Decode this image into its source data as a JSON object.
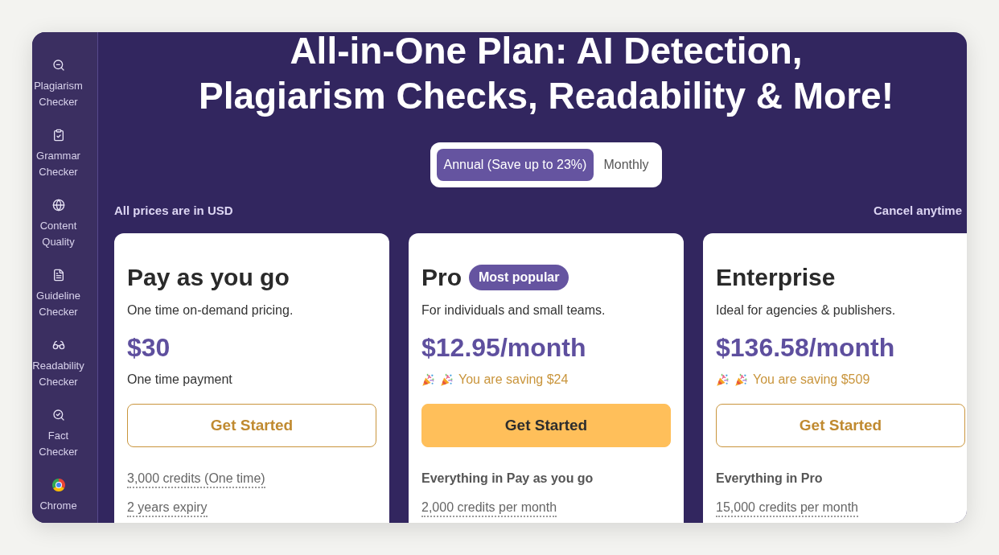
{
  "sidebar": {
    "items": [
      {
        "label": "Plagiarism Checker"
      },
      {
        "label": "Grammar Checker"
      },
      {
        "label": "Content Quality"
      },
      {
        "label": "Guideline Checker"
      },
      {
        "label": "Readability Checker"
      },
      {
        "label": "Fact Checker"
      },
      {
        "label": "Chrome"
      }
    ]
  },
  "title": "All-in-One Plan: AI Detection,\nPlagiarism Checks, Readability & More!",
  "billing_toggle": [
    {
      "label": "Annual (Save up to 23%)",
      "selected": true
    },
    {
      "label": "Monthly",
      "selected": false
    }
  ],
  "currency_note": "All prices are in USD",
  "cancel_note": "Cancel anytime",
  "plans": [
    {
      "name": "Pay as you go",
      "description": "One time on-demand pricing.",
      "price": "$30",
      "note": {
        "kind": "plain",
        "text": "One time payment"
      },
      "button": {
        "label": "Get Started",
        "filled": false
      },
      "features": [
        {
          "kind": "credit",
          "text": "3,000 credits (One time)"
        },
        {
          "kind": "credit",
          "text": "2 years expiry"
        }
      ]
    },
    {
      "name": "Pro",
      "badge": "Most popular",
      "description": "For individuals and small teams.",
      "price": "$12.95/month",
      "note": {
        "kind": "saving",
        "text": "You are saving $24"
      },
      "button": {
        "label": "Get Started",
        "filled": true
      },
      "features": [
        {
          "kind": "heading",
          "text": "Everything in Pay as you go"
        },
        {
          "kind": "credit",
          "text": "2,000 credits per month"
        }
      ]
    },
    {
      "name": "Enterprise",
      "description": "Ideal for agencies & publishers.",
      "price": "$136.58/month",
      "note": {
        "kind": "saving",
        "text": "You are saving $509"
      },
      "button": {
        "label": "Get Started",
        "filled": false
      },
      "features": [
        {
          "kind": "heading",
          "text": "Everything in Pro"
        },
        {
          "kind": "credit",
          "text": "15,000 credits per month"
        }
      ]
    }
  ]
}
